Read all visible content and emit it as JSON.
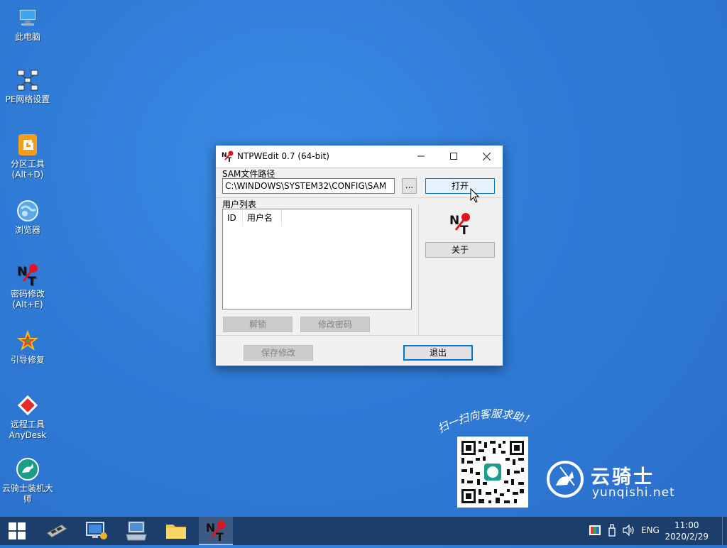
{
  "desktop_icons": [
    {
      "label": "此电脑",
      "icon": "computer-icon"
    },
    {
      "label": "PE网络设置",
      "icon": "network-icon"
    },
    {
      "label": "分区工具\n(Alt+D)",
      "icon": "partition-tool-icon"
    },
    {
      "label": "浏览器",
      "icon": "browser-icon"
    },
    {
      "label": "密码修改\n(Alt+E)",
      "icon": "ntpwedit-icon"
    },
    {
      "label": "引导修复",
      "icon": "boot-repair-icon"
    },
    {
      "label": "远程工具\nAnyDesk",
      "icon": "anydesk-icon"
    },
    {
      "label": "云骑士装机大\n师",
      "icon": "yunqishi-icon"
    }
  ],
  "window": {
    "title": "NTPWEdit 0.7 (64-bit)",
    "sam_group_label": "SAM文件路径",
    "sam_path_value": "C:\\WINDOWS\\SYSTEM32\\CONFIG\\SAM",
    "browse_label": "...",
    "open_label": "打开",
    "user_list_label": "用户列表",
    "columns": [
      "ID",
      "用户名"
    ],
    "unlock_label": "解锁",
    "change_password_label": "修改密码",
    "about_label": "关于",
    "save_label": "保存修改",
    "exit_label": "退出"
  },
  "promo": {
    "scan_text": "扫一扫向客服求助！",
    "brand_cn": "云骑士",
    "brand_url": "yunqishi.net"
  },
  "taskbar": {
    "language": "ENG",
    "time": "11:00",
    "date": "2020/2/29"
  },
  "colors": {
    "desktop": "#2f7bd6",
    "taskbar": "#1c3e6a",
    "accent": "#0078d7"
  }
}
